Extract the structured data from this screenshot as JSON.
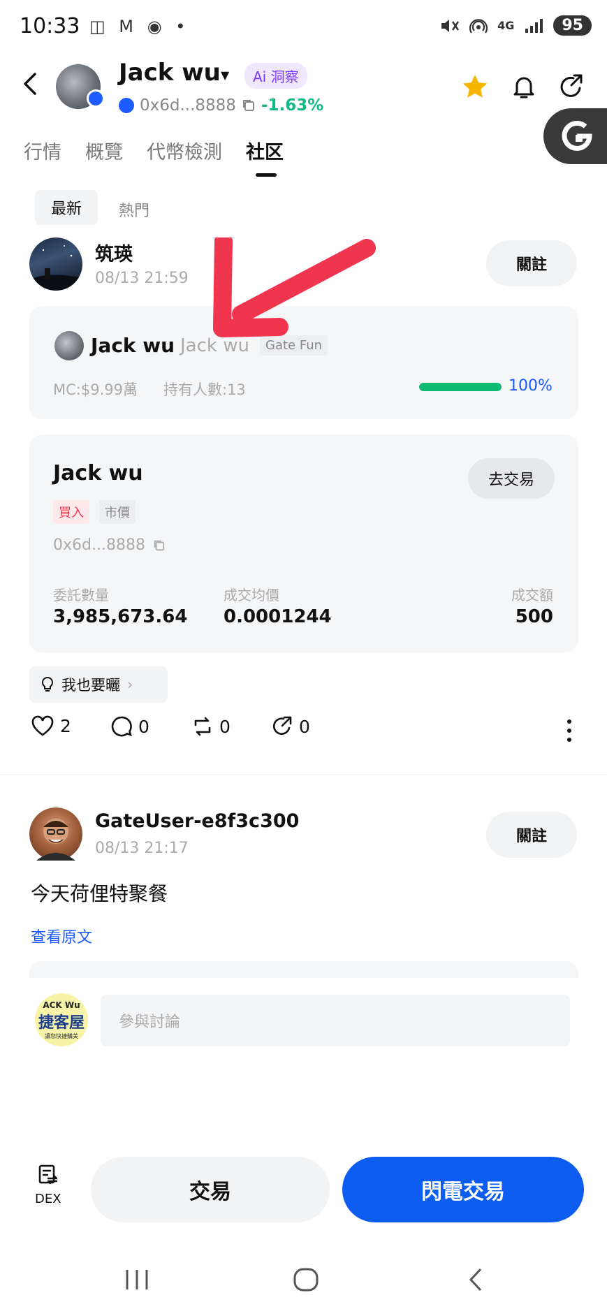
{
  "status_bar": {
    "time": "10:33",
    "notif_icons": "◫ M ◉ •",
    "net": "4G",
    "battery": "95"
  },
  "header": {
    "title": "Jack wu",
    "ai_label": "Ai 洞察",
    "address": "0x6d...8888",
    "change": "-1.63%"
  },
  "tabs": [
    {
      "label": "行情"
    },
    {
      "label": "概覽"
    },
    {
      "label": "代幣檢測"
    },
    {
      "label": "社区"
    }
  ],
  "subtabs": {
    "latest": "最新",
    "hot": "熱門"
  },
  "posts": [
    {
      "user": "筑瑛",
      "time": "08/13 21:59",
      "follow": "關註",
      "coin_card": {
        "name": "Jack wu",
        "sub": "Jack wu",
        "tag": "Gate Fun",
        "mc": "MC:$9.99萬",
        "holders": "持有人數:13",
        "progress": 1.0,
        "progress_label": "100%"
      },
      "trade_card": {
        "title": "Jack wu",
        "go_trade": "去交易",
        "side": "買入",
        "order_type": "市價",
        "address": "0x6d...8888",
        "qty_label": "委託數量",
        "qty": "3,985,673.64",
        "avg_label": "成交均價",
        "avg": "0.0001244",
        "amt_label": "成交額",
        "amt": "500"
      },
      "me_too": "我也要曬",
      "likes": "2",
      "comments": "0",
      "reposts": "0",
      "shares": "0"
    },
    {
      "user": "GateUser-e8f3c300",
      "time": "08/13 21:17",
      "follow": "關註",
      "text": "今天荷俚特聚餐",
      "view_original": "查看原文"
    }
  ],
  "comment_bar": {
    "avatar_line1": "ACK Wu",
    "avatar_line2": "捷客屋",
    "avatar_line3": "讓您快捷購美",
    "placeholder": "參與討論"
  },
  "bottom": {
    "dex_label": "DEX",
    "trade": "交易",
    "flash_trade": "閃電交易"
  },
  "colors": {
    "accent_blue": "#0c5cf0",
    "up_green": "#12b886",
    "buy_red": "#f23a4f",
    "annotation_red": "#f0364f"
  }
}
